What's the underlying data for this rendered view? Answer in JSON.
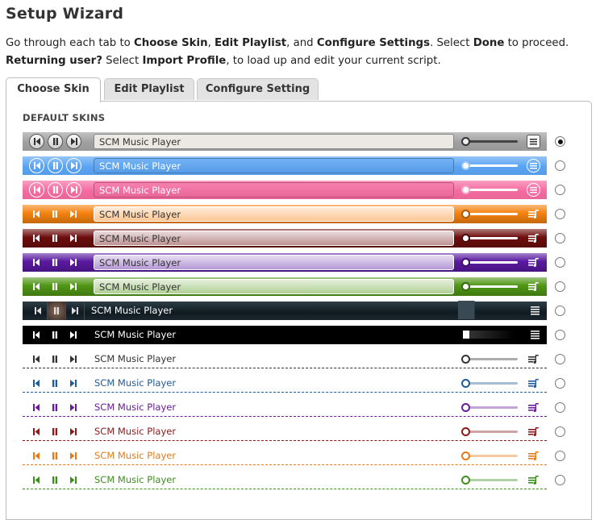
{
  "wizard": {
    "title": "Setup Wizard",
    "line1": {
      "a": "Go through each tab to ",
      "b": "Choose Skin",
      ",c": "",
      "c": ", ",
      "d": "Edit Playlist",
      "e": ", and ",
      "f": "Configure Settings",
      "g": ". Select ",
      "h": "Done",
      "i": " to proceed."
    },
    "line2": {
      "a": "Returning user?",
      "b": " Select ",
      "c": "Import Profile",
      "d": ", to load up and edit your current script."
    },
    "tabs": [
      {
        "label": "Choose Skin",
        "active": true
      },
      {
        "label": "Edit Playlist",
        "active": false
      },
      {
        "label": "Configure Setting",
        "active": false
      }
    ],
    "section_label": "DEFAULT SKINS"
  },
  "skins": [
    {
      "title": "SCM Music Player",
      "style": "simple",
      "color": "#a0a0a0",
      "selected": true
    },
    {
      "title": "SCM Music Player",
      "style": "simple",
      "color": "#5aa4f3",
      "selected": false
    },
    {
      "title": "SCM Music Player",
      "style": "simple",
      "color": "#f56ba0",
      "selected": false
    },
    {
      "title": "SCM Music Player",
      "style": "glossy",
      "color": "#f5820f",
      "selected": false
    },
    {
      "title": "SCM Music Player",
      "style": "glossy",
      "color": "#6e0d0d",
      "selected": false
    },
    {
      "title": "SCM Music Player",
      "style": "glossy",
      "color": "#5a19a0",
      "selected": false
    },
    {
      "title": "SCM Music Player",
      "style": "glossy",
      "color": "#4f9614",
      "selected": false
    },
    {
      "title": "SCM Music Player",
      "style": "dark",
      "color": "#1c2a33",
      "selected": false
    },
    {
      "title": "SCM Music Player",
      "style": "black",
      "color": "#000000",
      "selected": false
    },
    {
      "title": "SCM Music Player",
      "style": "flat",
      "color": "#333333",
      "selected": false
    },
    {
      "title": "SCM Music Player",
      "style": "flat",
      "color": "#1f5a99",
      "selected": false
    },
    {
      "title": "SCM Music Player",
      "style": "flat",
      "color": "#6a1b9a",
      "selected": false
    },
    {
      "title": "SCM Music Player",
      "style": "flat",
      "color": "#8b1a1a",
      "selected": false
    },
    {
      "title": "SCM Music Player",
      "style": "flat",
      "color": "#e67a1a",
      "selected": false
    },
    {
      "title": "SCM Music Player",
      "style": "flat",
      "color": "#3e8e1e",
      "selected": false
    }
  ]
}
